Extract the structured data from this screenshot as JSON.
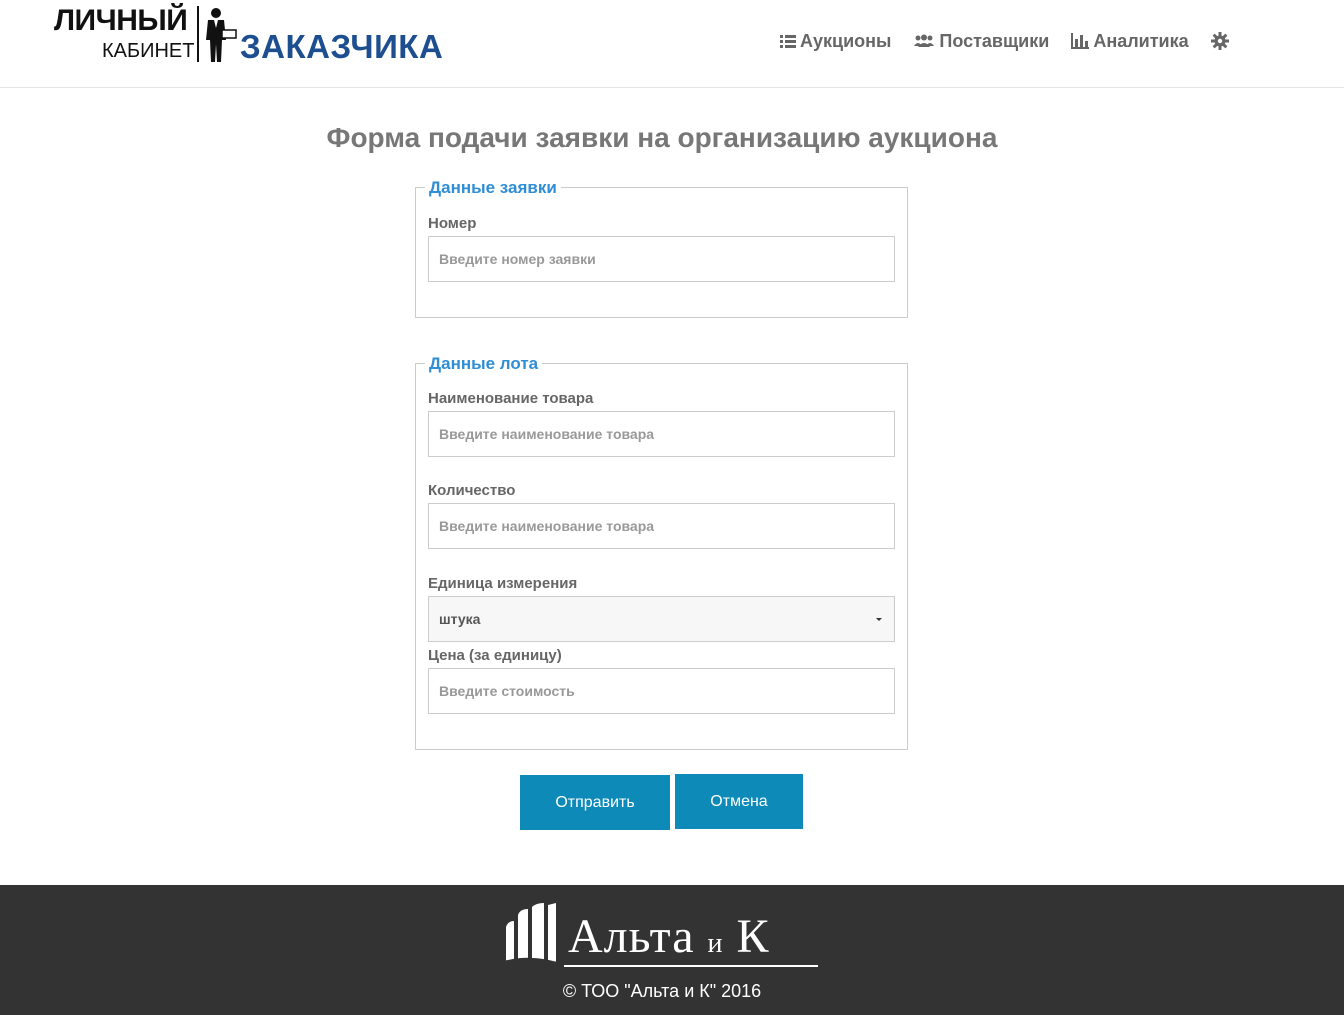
{
  "header": {
    "logo": {
      "line1": "ЛИЧНЫЙ",
      "line2": "КАБИНЕТ",
      "line3": "ЗАКАЗЧИКА",
      "brand_color": "#1d4e8f"
    },
    "nav": [
      {
        "label": "Аукционы",
        "icon": "list-icon"
      },
      {
        "label": "Поставщики",
        "icon": "users-icon"
      },
      {
        "label": "Аналитика",
        "icon": "bar-chart-icon"
      }
    ],
    "settings_icon": "gear-icon"
  },
  "page": {
    "title": "Форма подачи заявки на организацию аукциона"
  },
  "form": {
    "request_section": {
      "legend": "Данные заявки",
      "number_label": "Номер",
      "number_placeholder": "Введите номер заявки"
    },
    "lot_section": {
      "legend": "Данные лота",
      "product_label": "Наименование товара",
      "product_placeholder": "Введите наименование товара",
      "quantity_label": "Количество",
      "quantity_placeholder": "Введите наименование товара",
      "unit_label": "Единица измерения",
      "unit_value": "штука",
      "price_label": "Цена (за единицу)",
      "price_placeholder": "Введите стоимость"
    },
    "submit_label": "Отправить",
    "cancel_label": "Отмена",
    "accent_color": "#2f8ed5",
    "button_color": "#0e8ab8"
  },
  "footer": {
    "brand_main": "Альта",
    "brand_small": "и",
    "brand_end": "К",
    "copyright": "© ТОО \"Альта и К\" 2016",
    "background": "#333333"
  }
}
